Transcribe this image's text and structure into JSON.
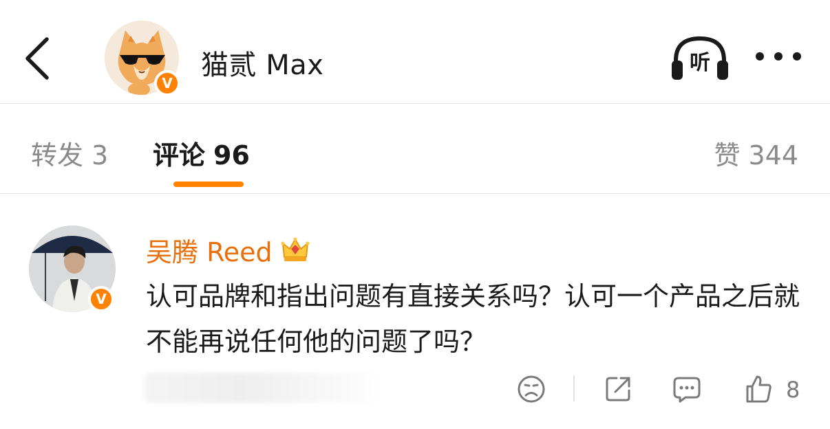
{
  "header": {
    "back_icon": "chevron-left-icon",
    "author_name": "猫贰 Max",
    "verified_badge": "V",
    "listen_label": "听",
    "listen_icon": "headphones-icon",
    "more_icon": "more-dots-icon"
  },
  "tabs": {
    "repost": {
      "label": "转发",
      "count": "3"
    },
    "comment": {
      "label": "评论",
      "count": "96",
      "active": true
    },
    "like": {
      "label": "赞",
      "count": "344"
    }
  },
  "comment": {
    "username": "吴腾 Reed",
    "verified_badge": "V",
    "crown_icon": "crown-icon",
    "text": "认可品牌和指出问题有直接关系吗？认可一个产品之后就不能再说任何他的问题了吗？",
    "actions": {
      "react_icon": "sad-face-icon",
      "share_icon": "share-icon",
      "reply_icon": "comment-bubble-icon",
      "like_icon": "thumbs-up-icon",
      "like_count": "8"
    }
  },
  "colors": {
    "accent": "#ff8200",
    "username": "#e8700c",
    "muted": "#8a8a8a",
    "divider": "#e8e8e8"
  }
}
